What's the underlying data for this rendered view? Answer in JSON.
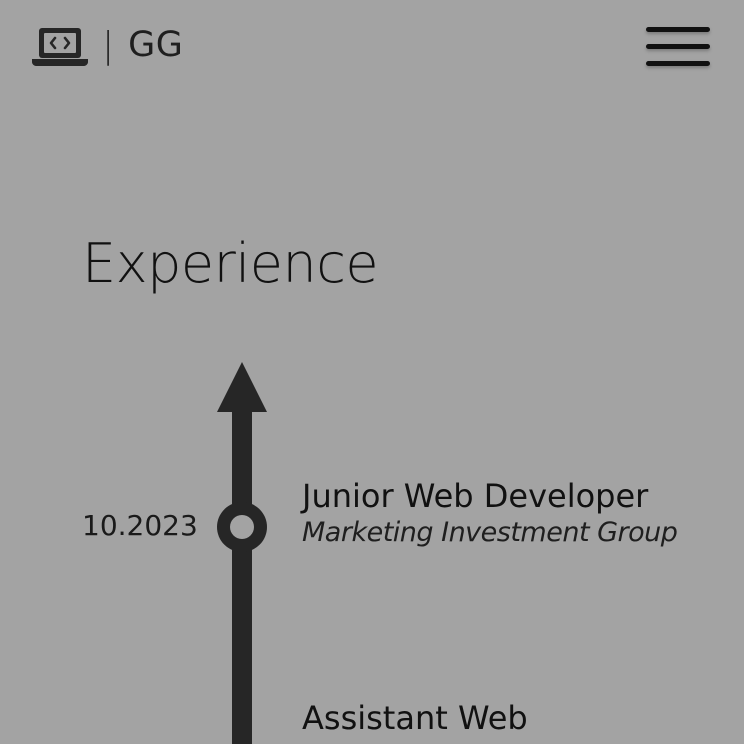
{
  "header": {
    "brand_icon": "laptop-code-icon",
    "divider": "|",
    "brand_text": "GG",
    "menu_icon": "hamburger-menu-icon"
  },
  "section": {
    "title": "Experience"
  },
  "timeline": {
    "arrow_icon": "up-arrow-icon",
    "entries": [
      {
        "date": "10.2023",
        "title": "Junior Web Developer",
        "company": "Marketing Investment Group"
      },
      {
        "title": "Assistant Web"
      }
    ]
  },
  "colors": {
    "background": "#a3a3a3",
    "timeline": "#262626",
    "text": "#111111"
  }
}
